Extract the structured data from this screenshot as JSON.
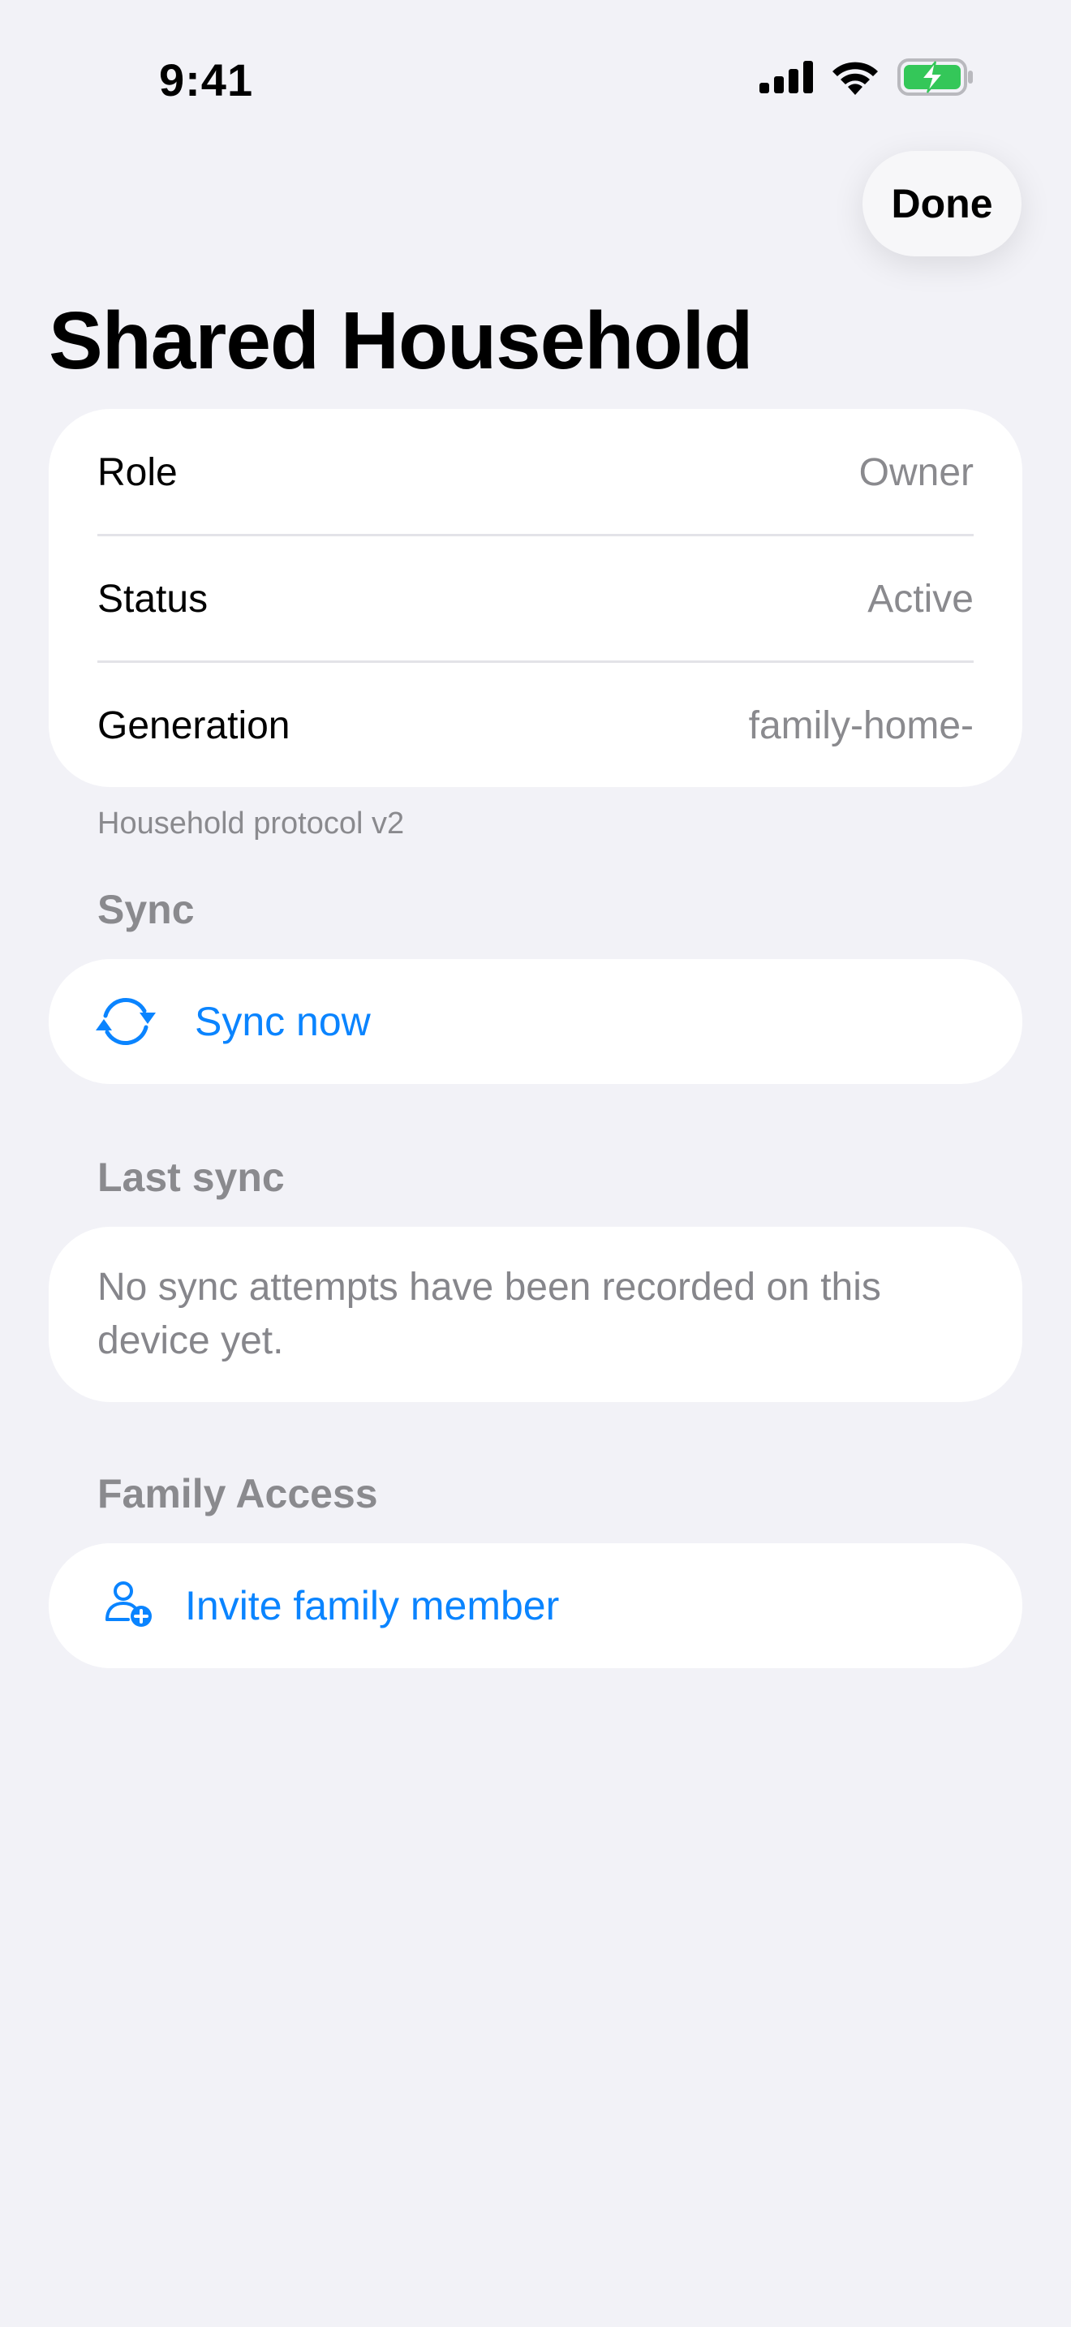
{
  "status_bar": {
    "time": "9:41",
    "icons": [
      "cellular-signal-icon",
      "wifi-icon",
      "battery-charging-icon"
    ]
  },
  "nav": {
    "done_label": "Done",
    "title": "Shared Household"
  },
  "info": {
    "rows": [
      {
        "label": "Role",
        "value": "Owner"
      },
      {
        "label": "Status",
        "value": "Active"
      },
      {
        "label": "Generation",
        "value": "family-home-"
      }
    ],
    "footnote": "Household protocol v2"
  },
  "sync": {
    "header": "Sync",
    "action_label": "Sync now",
    "icon": "sync-arrows-icon"
  },
  "last_sync": {
    "header": "Last sync",
    "message": "No sync attempts have been recorded on this device yet."
  },
  "family_access": {
    "header": "Family Access",
    "action_label": "Invite family member",
    "icon": "person-add-icon"
  },
  "colors": {
    "background": "#F2F2F7",
    "card": "#FFFFFF",
    "accent": "#0A84FF",
    "secondary_text": "#8A8A8E",
    "battery_green": "#34C759"
  }
}
